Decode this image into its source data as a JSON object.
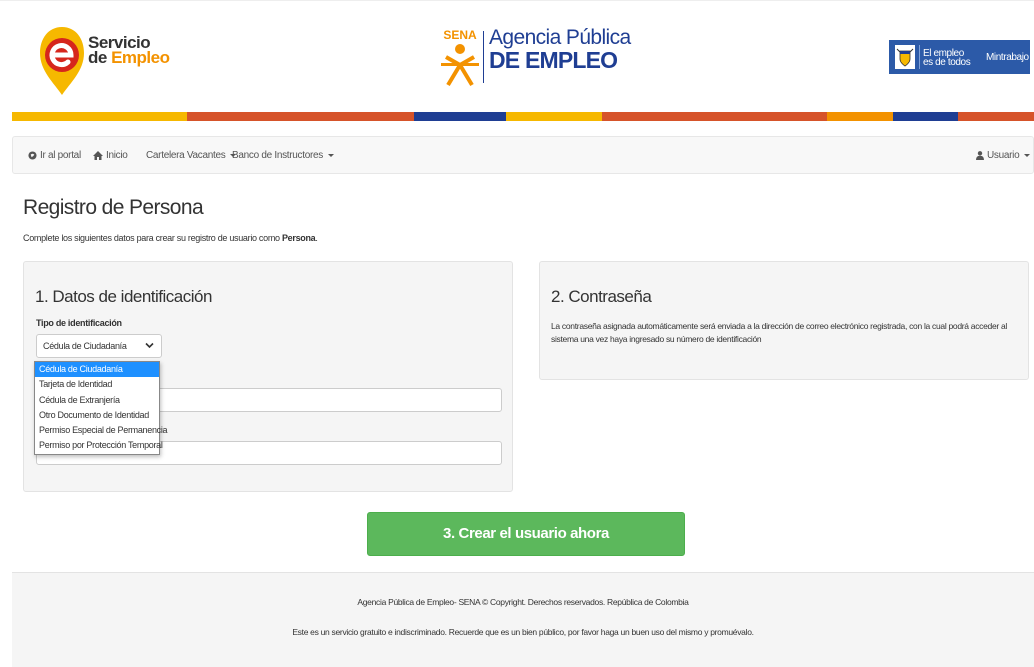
{
  "header": {
    "logo_servicio": {
      "line1": "Servicio",
      "line2_prefix": "de ",
      "line2_highlight": "Empleo"
    },
    "logo_sena": "SENA",
    "logo_agencia": {
      "line1": "Agencia Pública",
      "line2": "DE EMPLEO"
    },
    "gov_badge": {
      "line1": "El empleo",
      "line2": "es de todos",
      "ministry": "Mintrabajo"
    },
    "color_bar": [
      "#f6b800",
      "#d6532a",
      "#f6b800",
      "#d6532a",
      "#1f3e93",
      "#f6b800",
      "#d6532a",
      "#f6b800",
      "#d6532a",
      "#1f3e93"
    ]
  },
  "nav": {
    "portal": "Ir al portal",
    "home": "Inicio",
    "vacancies": "Cartelera Vacantes",
    "instructors": "Banco de Instructores",
    "user": "Usuario"
  },
  "page": {
    "title": "Registro de Persona",
    "intro_prefix": "Complete los siguientes datos para crear su registro de usuario como ",
    "intro_bold": "Persona",
    "intro_suffix": "."
  },
  "panel1": {
    "heading": "1. Datos de identificación",
    "id_type_label": "Tipo de identificación",
    "id_type_value": "Cédula de Ciudadanía",
    "options": [
      "Cédula de Ciudadanía",
      "Tarjeta de Identidad",
      "Cédula de Extranjería",
      "Otro Documento de Identidad",
      "Permiso Especial de Permanencia",
      "Permiso por Protección Temporal"
    ]
  },
  "panel2": {
    "heading": "2. Contraseña",
    "text": "La contraseña asignada automáticamente será enviada a la dirección de correo electrónico registrada, con la cual podrá acceder al sistema una vez haya ingresado su número de identificación"
  },
  "actions": {
    "create": "3. Crear el usuario ahora"
  },
  "footer": {
    "line1": "Agencia Pública de Empleo- SENA © Copyright. Derechos reservados. República de Colombia",
    "line2": "Este es un servicio gratuito e indiscriminado. Recuerde que es un bien público, por favor haga un buen uso del mismo y promuévalo."
  },
  "colors": {
    "accent_green": "#5cb85c",
    "select_blue": "#1e90ff",
    "brand_blue": "#1f3e93",
    "brand_orange": "#f39200"
  }
}
